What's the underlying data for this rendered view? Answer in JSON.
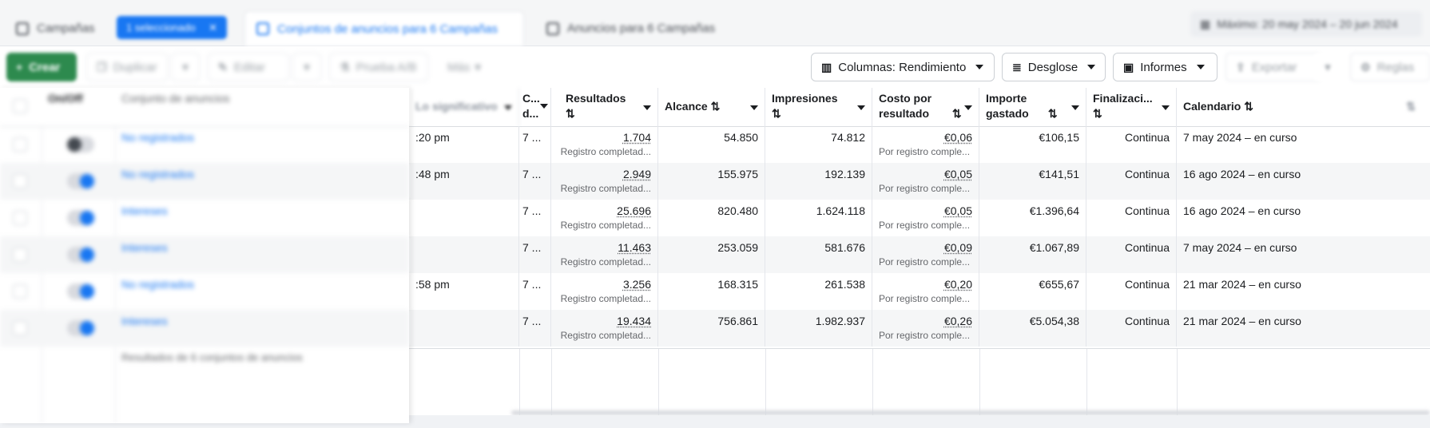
{
  "tabs": {
    "campaigns": "Campañas",
    "selected_pill": "1 seleccionado",
    "adsets": "Conjuntos de anuncios para 6 Campañas",
    "ads": "Anuncios para 6 Campañas",
    "date_range": "Máximo: 20 may 2024 – 20 jun 2024"
  },
  "toolbar": {
    "create": "Crear",
    "duplicate": "Duplicar",
    "edit": "Editar",
    "ab_test": "Prueba A/B",
    "more": "Más",
    "columns": "Columnas: Rendimiento",
    "breakdown": "Desglose",
    "reports": "Informes",
    "export": "Exportar",
    "rules": "Reglas"
  },
  "table": {
    "frozen_headers": {
      "onoff": "On/Off",
      "name": "Conjunto de anuncios"
    },
    "headers": {
      "significant": "Lo significativo",
      "c": "C... d...",
      "results": "Resultados",
      "reach": "Alcance",
      "impressions": "Impresiones",
      "cost_per_result": "Costo por resultado",
      "amount_spent": "Importe gastado",
      "ends": "Finalizaci...",
      "schedule": "Calendario"
    },
    "rows": [
      {
        "toggle": "off",
        "name": "No registrados",
        "time": ":20 pm",
        "c": "7 ...",
        "results": "1.704",
        "results_sub": "Registro completad...",
        "reach": "54.850",
        "impressions": "74.812",
        "cpr": "€0,06",
        "cpr_sub": "Por registro comple...",
        "spent": "€106,15",
        "ends": "Continua",
        "schedule": "7 may 2024 – en curso"
      },
      {
        "toggle": "on",
        "name": "No registrados",
        "time": ":48 pm",
        "c": "7 ...",
        "results": "2.949",
        "results_sub": "Registro completad...",
        "reach": "155.975",
        "impressions": "192.139",
        "cpr": "€0,05",
        "cpr_sub": "Por registro comple...",
        "spent": "€141,51",
        "ends": "Continua",
        "schedule": "16 ago 2024 – en curso"
      },
      {
        "toggle": "on",
        "name": "Intereses",
        "time": "",
        "c": "7 ...",
        "results": "25.696",
        "results_sub": "Registro completad...",
        "reach": "820.480",
        "impressions": "1.624.118",
        "cpr": "€0,05",
        "cpr_sub": "Por registro comple...",
        "spent": "€1.396,64",
        "ends": "Continua",
        "schedule": "16 ago 2024 – en curso"
      },
      {
        "toggle": "on",
        "name": "Intereses",
        "time": "",
        "c": "7 ...",
        "results": "11.463",
        "results_sub": "Registro completad...",
        "reach": "253.059",
        "impressions": "581.676",
        "cpr": "€0,09",
        "cpr_sub": "Por registro comple...",
        "spent": "€1.067,89",
        "ends": "Continua",
        "schedule": "7 may 2024 – en curso"
      },
      {
        "toggle": "on",
        "name": "No registrados",
        "time": ":58 pm",
        "c": "7 ...",
        "results": "3.256",
        "results_sub": "Registro completad...",
        "reach": "168.315",
        "impressions": "261.538",
        "cpr": "€0,20",
        "cpr_sub": "Por registro comple...",
        "spent": "€655,67",
        "ends": "Continua",
        "schedule": "21 mar 2024 – en curso"
      },
      {
        "toggle": "on",
        "name": "Intereses",
        "time": "",
        "c": "7 ...",
        "results": "19.434",
        "results_sub": "Registro completad...",
        "reach": "756.861",
        "impressions": "1.982.937",
        "cpr": "€0,26",
        "cpr_sub": "Por registro comple...",
        "spent": "€5.054,38",
        "ends": "Continua",
        "schedule": "21 mar 2024 – en curso"
      }
    ],
    "summary": "Resultados de 6 conjuntos de anuncios"
  },
  "colors": {
    "accent": "#1877f2",
    "create": "#2d8a4e"
  }
}
